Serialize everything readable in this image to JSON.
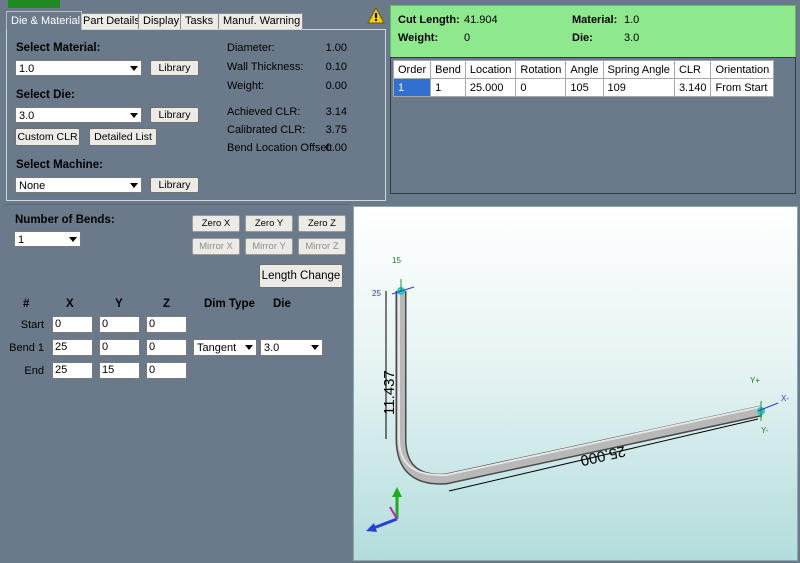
{
  "tabs": [
    {
      "label": "Die & Material",
      "active": true
    },
    {
      "label": "Part Details",
      "active": false
    },
    {
      "label": "Display",
      "active": false
    },
    {
      "label": "Tasks",
      "active": false
    },
    {
      "label": "Manuf. Warning",
      "active": false
    }
  ],
  "die_material": {
    "select_material_label": "Select Material:",
    "material_value": "1.0",
    "select_die_label": "Select Die:",
    "die_value": "3.0",
    "select_machine_label": "Select Machine:",
    "machine_value": "None",
    "library_label": "Library",
    "custom_clr_label": "Custom CLR",
    "detailed_list_label": "Detailed List",
    "info": [
      {
        "label": "Diameter:",
        "value": "1.00"
      },
      {
        "label": "Wall Thickness:",
        "value": "0.10"
      },
      {
        "label": "Weight:",
        "value": "0.00"
      },
      {
        "label": "Achieved CLR:",
        "value": "3.14"
      },
      {
        "label": "Calibrated CLR:",
        "value": "3.75"
      },
      {
        "label": "Bend Location Offset:",
        "value": "0.00"
      }
    ]
  },
  "summary": {
    "cut_length_label": "Cut Length:",
    "cut_length_value": "41.904",
    "weight_label": "Weight:",
    "weight_value": "0",
    "material_label": "Material:",
    "material_value": "1.0",
    "die_label": "Die:",
    "die_value": "3.0",
    "background_color": "#8ee88e"
  },
  "bend_table": {
    "columns": [
      "Order",
      "Bend",
      "Location",
      "Rotation",
      "Angle",
      "Spring Angle",
      "CLR",
      "Orientation"
    ],
    "rows": [
      [
        "1",
        "1",
        "25.000",
        "0",
        "105",
        "109",
        "3.140",
        "From Start"
      ]
    ]
  },
  "bends": {
    "number_label": "Number of Bends:",
    "number_value": "1",
    "buttons": {
      "zero_x": "Zero X",
      "zero_y": "Zero Y",
      "zero_z": "Zero Z",
      "mirror_x": "Mirror X",
      "mirror_y": "Mirror Y",
      "mirror_z": "Mirror Z",
      "length_change": "Length Change"
    },
    "headers": {
      "num": "#",
      "x": "X",
      "y": "Y",
      "z": "Z",
      "dim_type": "Dim Type",
      "die": "Die"
    },
    "rows": [
      {
        "label": "Start",
        "x": "0",
        "y": "0",
        "z": "0"
      },
      {
        "label": "Bend 1",
        "x": "25",
        "y": "0",
        "z": "0",
        "dim_type": "Tangent",
        "die": "3.0"
      },
      {
        "label": "End",
        "x": "25",
        "y": "15",
        "z": "0"
      }
    ]
  },
  "view3d": {
    "dim_vertical": "11.437",
    "dim_horizontal": "25.000",
    "marker_15": "15",
    "marker_25": "25",
    "axis_yplus": "Y+",
    "axis_xminus": "X-",
    "axis_yminus": "Y-"
  },
  "icons": {
    "warning": "warning-triangle-icon"
  }
}
